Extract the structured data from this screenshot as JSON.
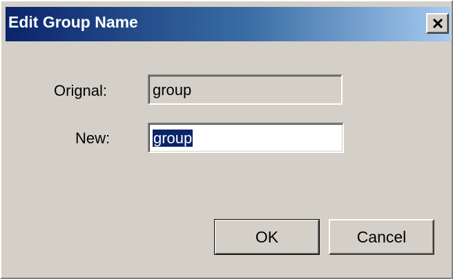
{
  "dialog": {
    "title": "Edit Group Name",
    "close_icon": "close-icon"
  },
  "form": {
    "original_label": "Orignal:",
    "original_value": "group",
    "new_label": "New:",
    "new_value": "group"
  },
  "buttons": {
    "ok_label": "OK",
    "cancel_label": "Cancel"
  },
  "colors": {
    "titlebar_start": "#0a246a",
    "titlebar_end": "#a6caf0",
    "face": "#d4d0c8",
    "selection": "#0a246a"
  }
}
